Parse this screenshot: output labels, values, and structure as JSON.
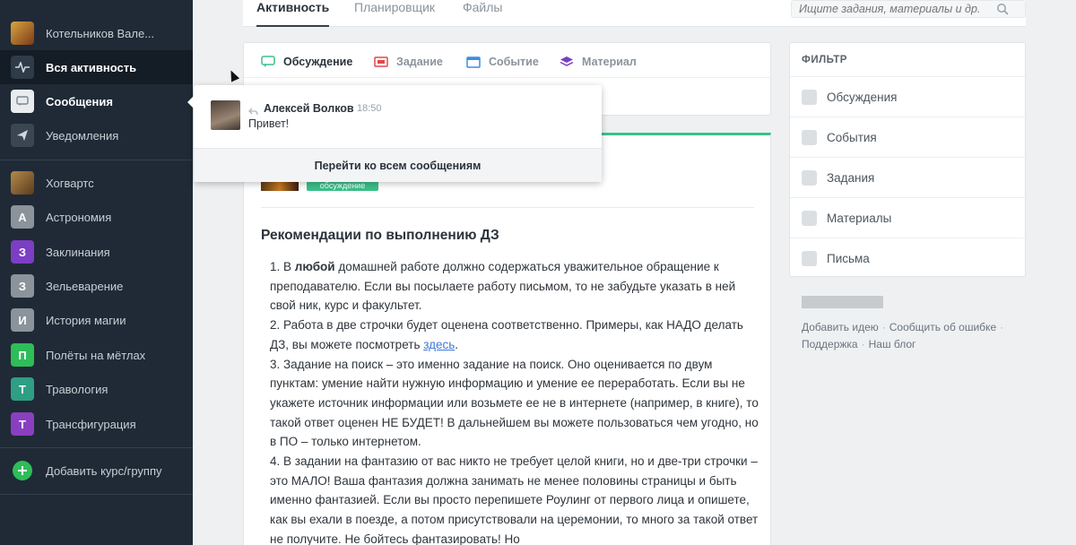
{
  "sidebar": {
    "user": {
      "label": "Котельников Вале..."
    },
    "items": [
      {
        "label": "Вся активность"
      },
      {
        "label": "Сообщения"
      },
      {
        "label": "Уведомления"
      }
    ],
    "courses": [
      {
        "letter": "",
        "label": "Хогвартс",
        "color": "#8a6a3c"
      },
      {
        "letter": "А",
        "label": "Астрономия",
        "color": "#8b939b"
      },
      {
        "letter": "З",
        "label": "Заклинания",
        "color": "#7b3ec4"
      },
      {
        "letter": "З",
        "label": "Зельеварение",
        "color": "#8b939b"
      },
      {
        "letter": "И",
        "label": "История магии",
        "color": "#8b939b"
      },
      {
        "letter": "П",
        "label": "Полёты на мётлах",
        "color": "#2ebd59"
      },
      {
        "letter": "Т",
        "label": "Травология",
        "color": "#2e9e84"
      },
      {
        "letter": "Т",
        "label": "Трансфигурация",
        "color": "#8a3fc0"
      }
    ],
    "add_course": "Добавить курс/группу"
  },
  "topbar": {
    "tabs": [
      "Активность",
      "Планировщик",
      "Файлы"
    ],
    "search_placeholder": "Ищите задания, материалы и др."
  },
  "composer": {
    "tabs": [
      "Обсуждение",
      "Задание",
      "Событие",
      "Материал"
    ]
  },
  "popup": {
    "name": "Алексей Волков",
    "time": "18:50",
    "message": "Привет!",
    "footer": "Перейти ко всем сообщениям"
  },
  "post": {
    "tag": "обсуждение",
    "title": "Рекомендации по выполнению ДЗ",
    "p1_prefix": "1. В ",
    "p1_bold": "любой",
    "p1_rest": " домашней работе должно содержаться уважительное обращение к преподавателю. Если вы посылаете работу письмом, то не забудьте указать в ней свой ник, курс и факультет.",
    "p2_prefix": "2. Работа в две строчки будет оценена соответственно. Примеры, как НАДО делать ДЗ, вы можете посмотреть ",
    "p2_link": "здесь",
    "p2_suffix": ".",
    "p3": "3. Задание на поиск – это именно задание на поиск. Оно оценивается по двум пунктам: умение найти нужную информацию и умение ее переработать. Если вы не укажете источник информации или возьмете ее не в интернете (например, в книге), то такой ответ оценен НЕ БУДЕТ! В дальнейшем вы можете пользоваться чем угодно, но в ПО – только интернетом.",
    "p4": "4. В задании на фантазию от вас никто не требует целой книги, но и две-три строчки – это МАЛО! Ваша фантазия должна занимать не менее половины страницы и быть именно фантазией. Если вы просто перепишете Роулинг от первого лица и опишете, как вы ехали в поезде, а потом присутствовали на церемонии, то много за такой ответ не получите. Не бойтесь фантазировать! Но"
  },
  "filter": {
    "title": "ФИЛЬТР",
    "options": [
      "Обсуждения",
      "События",
      "Задания",
      "Материалы",
      "Письма"
    ]
  },
  "footer_links": {
    "idea": "Добавить идею",
    "bug": "Сообщить об ошибке",
    "support": "Поддержка",
    "blog": "Наш блог"
  },
  "colors": {
    "sidebar_bg": "#1f2a36",
    "accent_green": "#3cbf8a",
    "link_blue": "#3d78d8"
  }
}
